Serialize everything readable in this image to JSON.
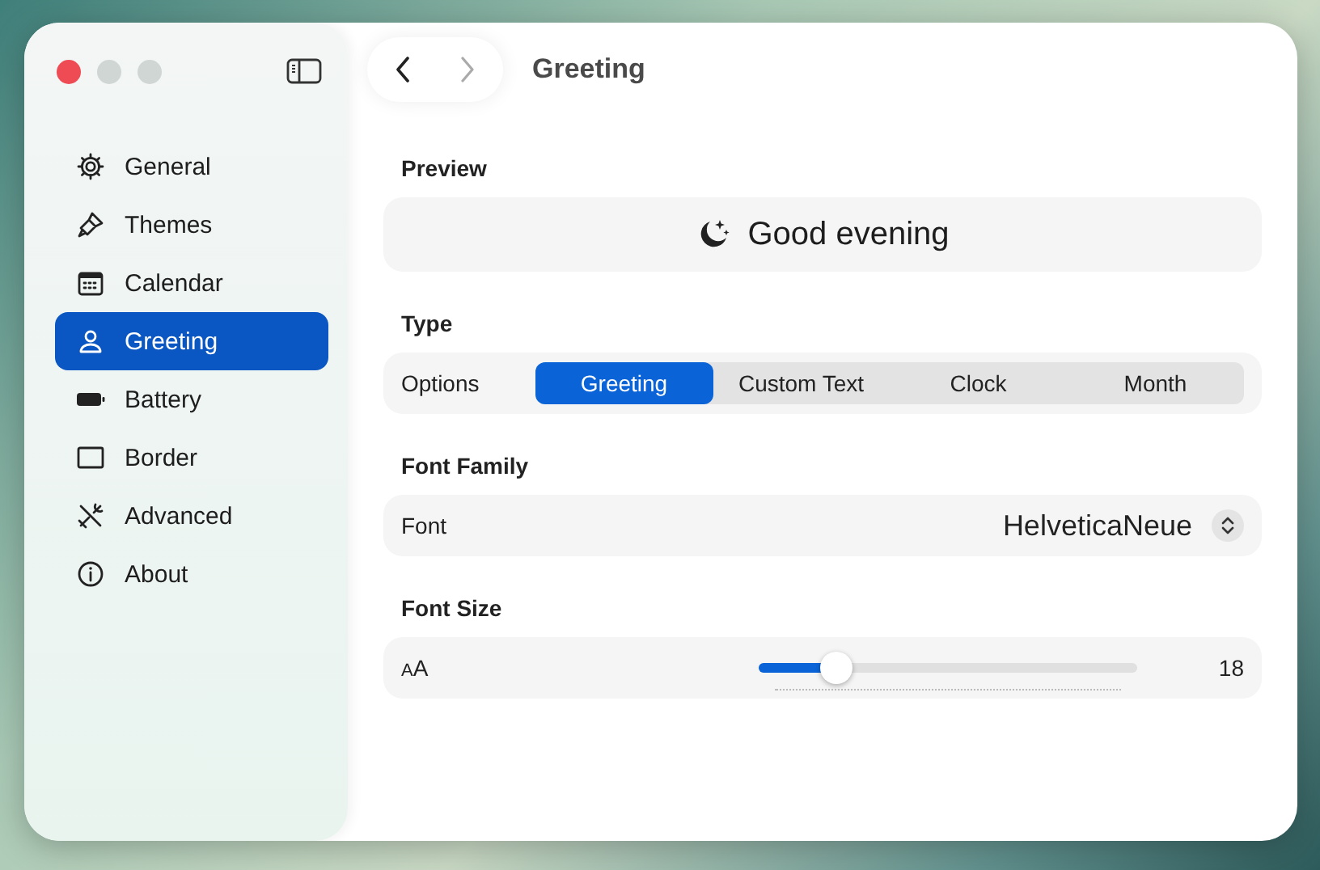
{
  "window": {
    "title": "Greeting"
  },
  "sidebar": {
    "items": [
      {
        "label": "General",
        "selected": false
      },
      {
        "label": "Themes",
        "selected": false
      },
      {
        "label": "Calendar",
        "selected": false
      },
      {
        "label": "Greeting",
        "selected": true
      },
      {
        "label": "Battery",
        "selected": false
      },
      {
        "label": "Border",
        "selected": false
      },
      {
        "label": "Advanced",
        "selected": false
      },
      {
        "label": "About",
        "selected": false
      }
    ]
  },
  "preview": {
    "heading": "Preview",
    "text": "Good evening"
  },
  "type": {
    "heading": "Type",
    "label": "Options",
    "segments": [
      {
        "label": "Greeting",
        "selected": true
      },
      {
        "label": "Custom Text",
        "selected": false
      },
      {
        "label": "Clock",
        "selected": false
      },
      {
        "label": "Month",
        "selected": false
      }
    ]
  },
  "font_family": {
    "heading": "Font Family",
    "label": "Font",
    "value": "HelveticaNeue"
  },
  "font_size": {
    "heading": "Font Size",
    "label": "AA",
    "level": 0.18,
    "reading": "18"
  }
}
